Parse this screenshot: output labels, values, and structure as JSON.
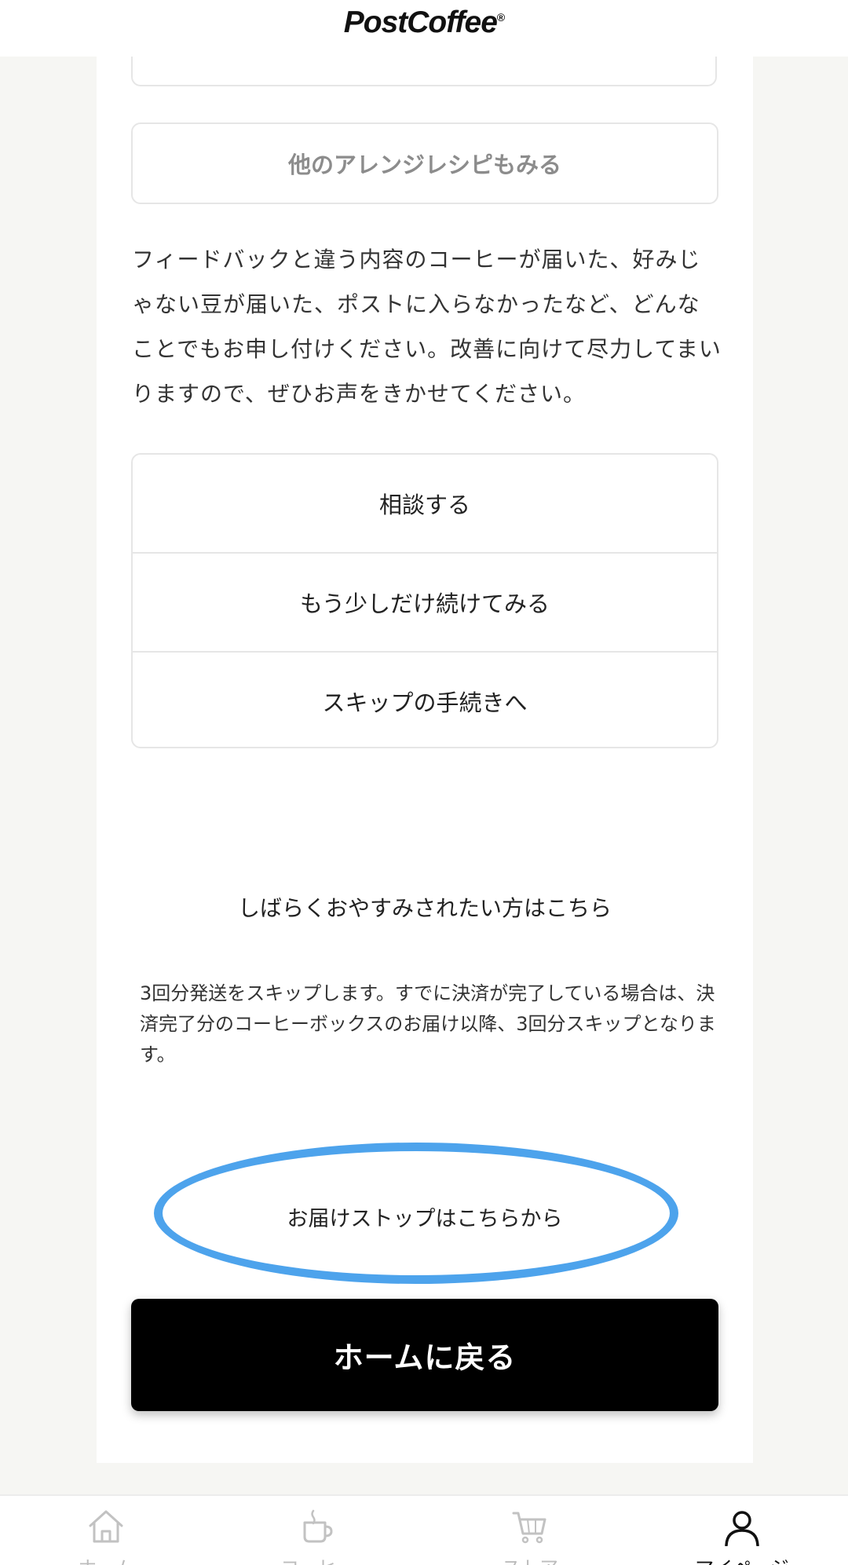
{
  "header": {
    "logo": "PostCoffee",
    "logo_mark": "®"
  },
  "main": {
    "recipe_button": "他のアレンジレシピもみる",
    "feedback_text": "フィードバックと違う内容のコーヒーが届いた、好みじゃない豆が届いた、ポストに入らなかったなど、どんなことでもお申し付けください。改善に向けて尽力してまいりますので、ぜひお声をきかせてください。",
    "options": [
      {
        "label": "相談する"
      },
      {
        "label": "もう少しだけ続けてみる"
      },
      {
        "label": "スキップの手続きへ"
      }
    ],
    "pause_title": "しばらくおやすみされたい方はこちら",
    "skip_text": "3回分発送をスキップします。すでに決済が完了している場合は、決済完了分のコーヒーボックスのお届け以降、3回分スキップとなります。",
    "stop_link": "お届けストップはこちらから",
    "home_button": "ホームに戻る",
    "highlight_color": "#4da3ec"
  },
  "nav": {
    "items": [
      {
        "label": "ホーム",
        "icon": "home-icon"
      },
      {
        "label": "コーヒー",
        "icon": "coffee-cup-icon"
      },
      {
        "label": "ストア",
        "icon": "cart-icon"
      },
      {
        "label": "マイページ",
        "icon": "user-icon"
      }
    ]
  }
}
